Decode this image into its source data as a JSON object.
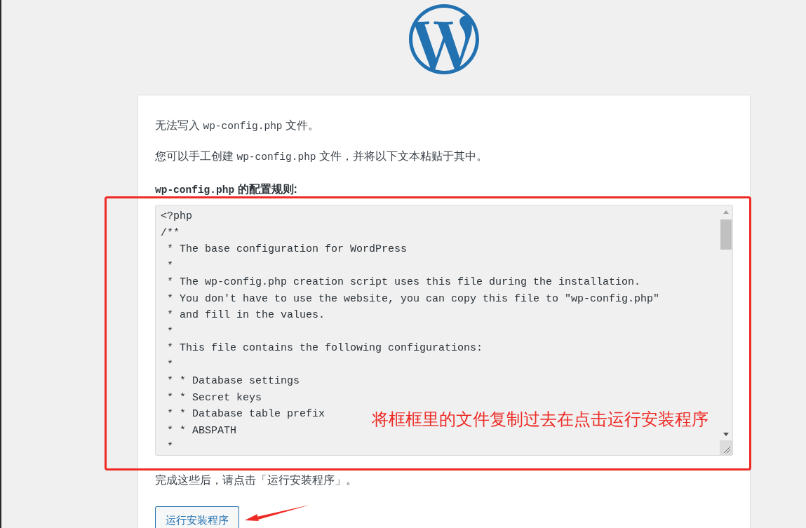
{
  "messages": [
    {
      "segments": [
        {
          "kind": "text",
          "text": "无法写入 "
        },
        {
          "kind": "code",
          "text": "wp-config.php"
        },
        {
          "kind": "text",
          "text": " 文件。"
        }
      ]
    },
    {
      "segments": [
        {
          "kind": "text",
          "text": "您可以手工创建 "
        },
        {
          "kind": "code",
          "text": "wp-config.php"
        },
        {
          "kind": "text",
          "text": " 文件，并将以下文本粘贴于其中。"
        }
      ]
    }
  ],
  "config_label": {
    "segments": [
      {
        "kind": "code",
        "text": "wp-config.php"
      },
      {
        "kind": "text",
        "text": " 的配置规则:"
      }
    ]
  },
  "config_text": {
    "lines": [
      "<?php",
      "/**",
      " * The base configuration for WordPress",
      " *",
      " * The wp-config.php creation script uses this file during the installation.",
      " * You don't have to use the website, you can copy this file to \"wp-config.php\"",
      " * and fill in the values.",
      " *",
      " * This file contains the following configurations:",
      " *",
      " * * Database settings",
      " * * Secret keys",
      " * * Database table prefix",
      " * * ABSPATH",
      " *"
    ]
  },
  "instruction": "完成这些后，请点击「运行安装程序」。",
  "run_button": {
    "label": "运行安装程序"
  },
  "annotation": {
    "note": "将框框里的文件复制过去在点击运行安装程序"
  }
}
